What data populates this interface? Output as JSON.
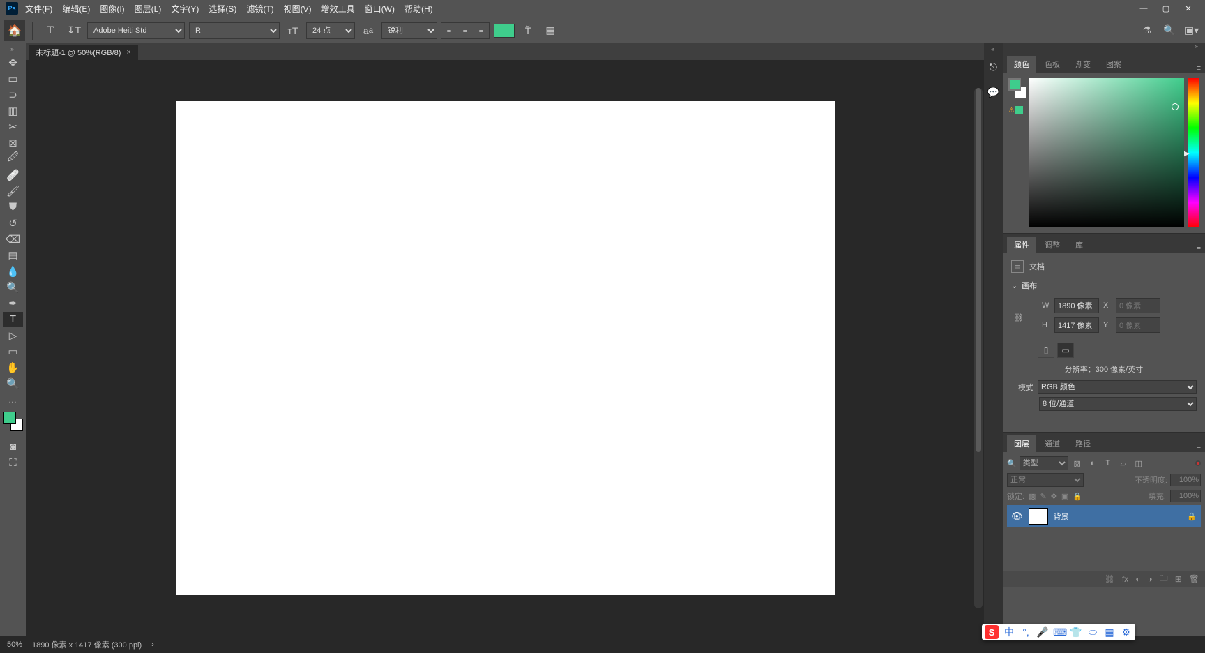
{
  "menubar": {
    "items": [
      "文件(F)",
      "编辑(E)",
      "图像(I)",
      "图层(L)",
      "文字(Y)",
      "选择(S)",
      "滤镜(T)",
      "视图(V)",
      "增效工具",
      "窗口(W)",
      "帮助(H)"
    ]
  },
  "options": {
    "font_family": "Adobe Heiti Std",
    "font_style": "R",
    "font_size": "24 点",
    "aa_mode": "锐利",
    "text_color": "#3fcd8c"
  },
  "document": {
    "tab_title": "未标题-1 @ 50%(RGB/8)"
  },
  "panels": {
    "color": {
      "tabs": [
        "颜色",
        "色板",
        "渐变",
        "图案"
      ]
    },
    "properties": {
      "tabs": [
        "属性",
        "调整",
        "库"
      ],
      "doc_label": "文档",
      "section": "画布",
      "w_label": "W",
      "w_value": "1890 像素",
      "x_label": "X",
      "x_value": "0 像素",
      "h_label": "H",
      "h_value": "1417 像素",
      "y_label": "Y",
      "y_value": "0 像素",
      "res_label": "分辨率：300 像素/英寸",
      "mode_label": "模式",
      "mode_value": "RGB 颜色",
      "depth_value": "8 位/通道"
    },
    "layers": {
      "tabs": [
        "图层",
        "通道",
        "路径"
      ],
      "kind_label": "类型",
      "blend_mode": "正常",
      "opacity_label": "不透明度:",
      "opacity_value": "100%",
      "lock_label": "锁定:",
      "fill_label": "填充:",
      "fill_value": "100%",
      "layer_name": "背景"
    }
  },
  "status": {
    "zoom": "50%",
    "dims": "1890 像素 x 1417 像素 (300 ppi)"
  },
  "ime": {
    "mode": "中"
  }
}
